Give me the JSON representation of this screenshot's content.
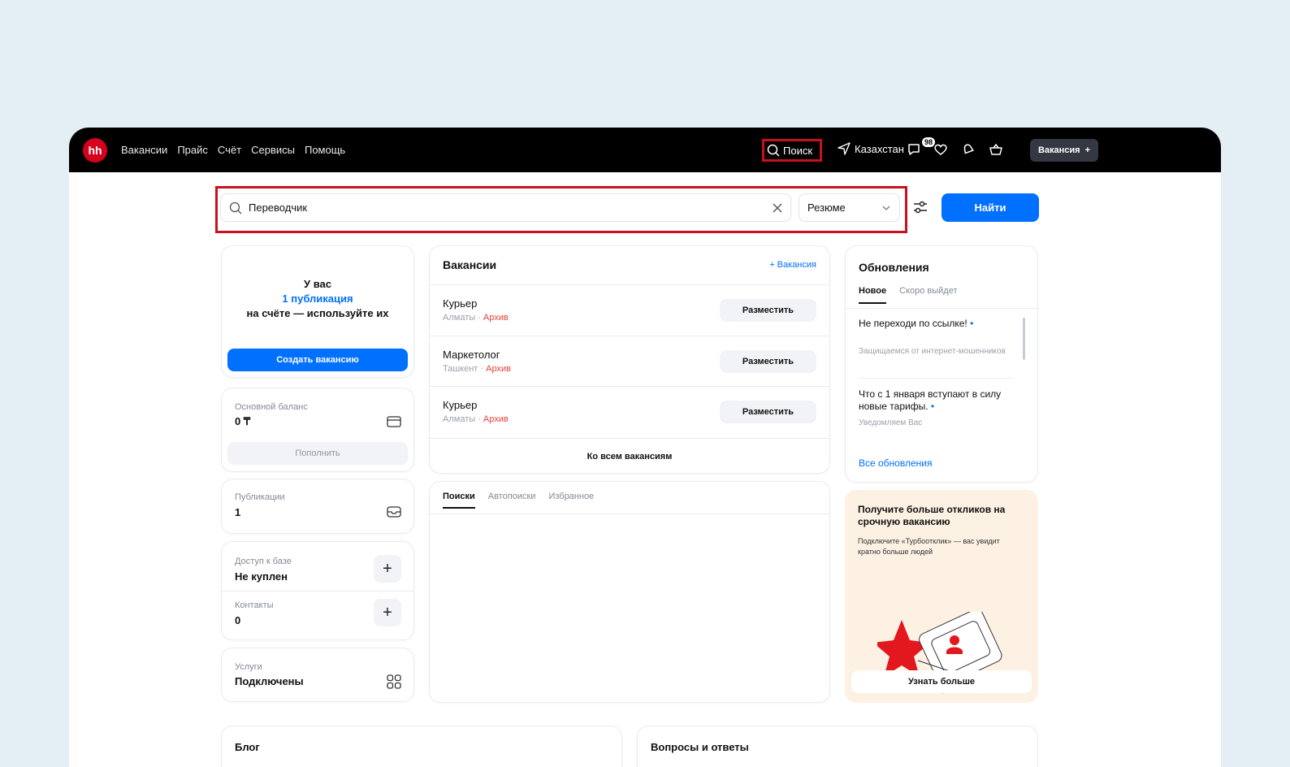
{
  "header": {
    "logo": "hh",
    "nav": [
      "Вакансии",
      "Прайс",
      "Счёт",
      "Сервисы",
      "Помощь"
    ],
    "search_label": "Поиск",
    "country": "Казахстан",
    "notifications_badge": "98",
    "vacancy_button": "Вакансия",
    "vacancy_button_plus": "+"
  },
  "search": {
    "query": "Переводчик",
    "type_select": "Резюме",
    "find_button": "Найти"
  },
  "publication_card": {
    "line1": "У вас",
    "line2": "1 публикация",
    "line3": "на счёте — используйте их",
    "create_button": "Создать вакансию"
  },
  "balance_card": {
    "label": "Основной баланс",
    "value": "0 ₸",
    "topup_button": "Пополнить"
  },
  "publications_card": {
    "label": "Публикации",
    "value": "1"
  },
  "access_card": {
    "db_label": "Доступ к базе",
    "db_value": "Не куплен",
    "contacts_label": "Контакты",
    "contacts_value": "0"
  },
  "services_card": {
    "label": "Услуги",
    "value": "Подключены"
  },
  "vacancies": {
    "title": "Вакансии",
    "add_link": "+ Вакансия",
    "items": [
      {
        "title": "Курьер",
        "city": "Алматы · ",
        "status": "Архив",
        "button": "Разместить"
      },
      {
        "title": "Маркетолог",
        "city": "Ташкент · ",
        "status": "Архив",
        "button": "Разместить"
      },
      {
        "title": "Курьер",
        "city": "Алматы · ",
        "status": "Архив",
        "button": "Разместить"
      }
    ],
    "all_link": "Ко всем вакансиям"
  },
  "search_tabs": [
    "Поиски",
    "Автопоиски",
    "Избранное"
  ],
  "updates": {
    "title": "Обновления",
    "tabs": [
      "Новое",
      "Скоро выйдет"
    ],
    "items": [
      {
        "title": "Не переходи по ссылке!",
        "dot": "•",
        "desc": "Защищаемся от интернет-мошенников"
      },
      {
        "title": "Что с 1 января вступают в силу новые тарифы.",
        "dot": "•",
        "desc": "Уведомляем Вас"
      }
    ],
    "all_link": "Все обновления"
  },
  "promo": {
    "title": "Получите больше откликов на срочную вакансию",
    "text": "Подключите «Турбоотклик» — вас увидит кратно больше людей",
    "button": "Узнать больше"
  },
  "bottom": {
    "blog": "Блог",
    "qa": "Вопросы и ответы"
  },
  "colors": {
    "accent": "#0070ff",
    "brand": "#d6001c",
    "highlight": "#c8101e",
    "archive": "#e8423a"
  }
}
